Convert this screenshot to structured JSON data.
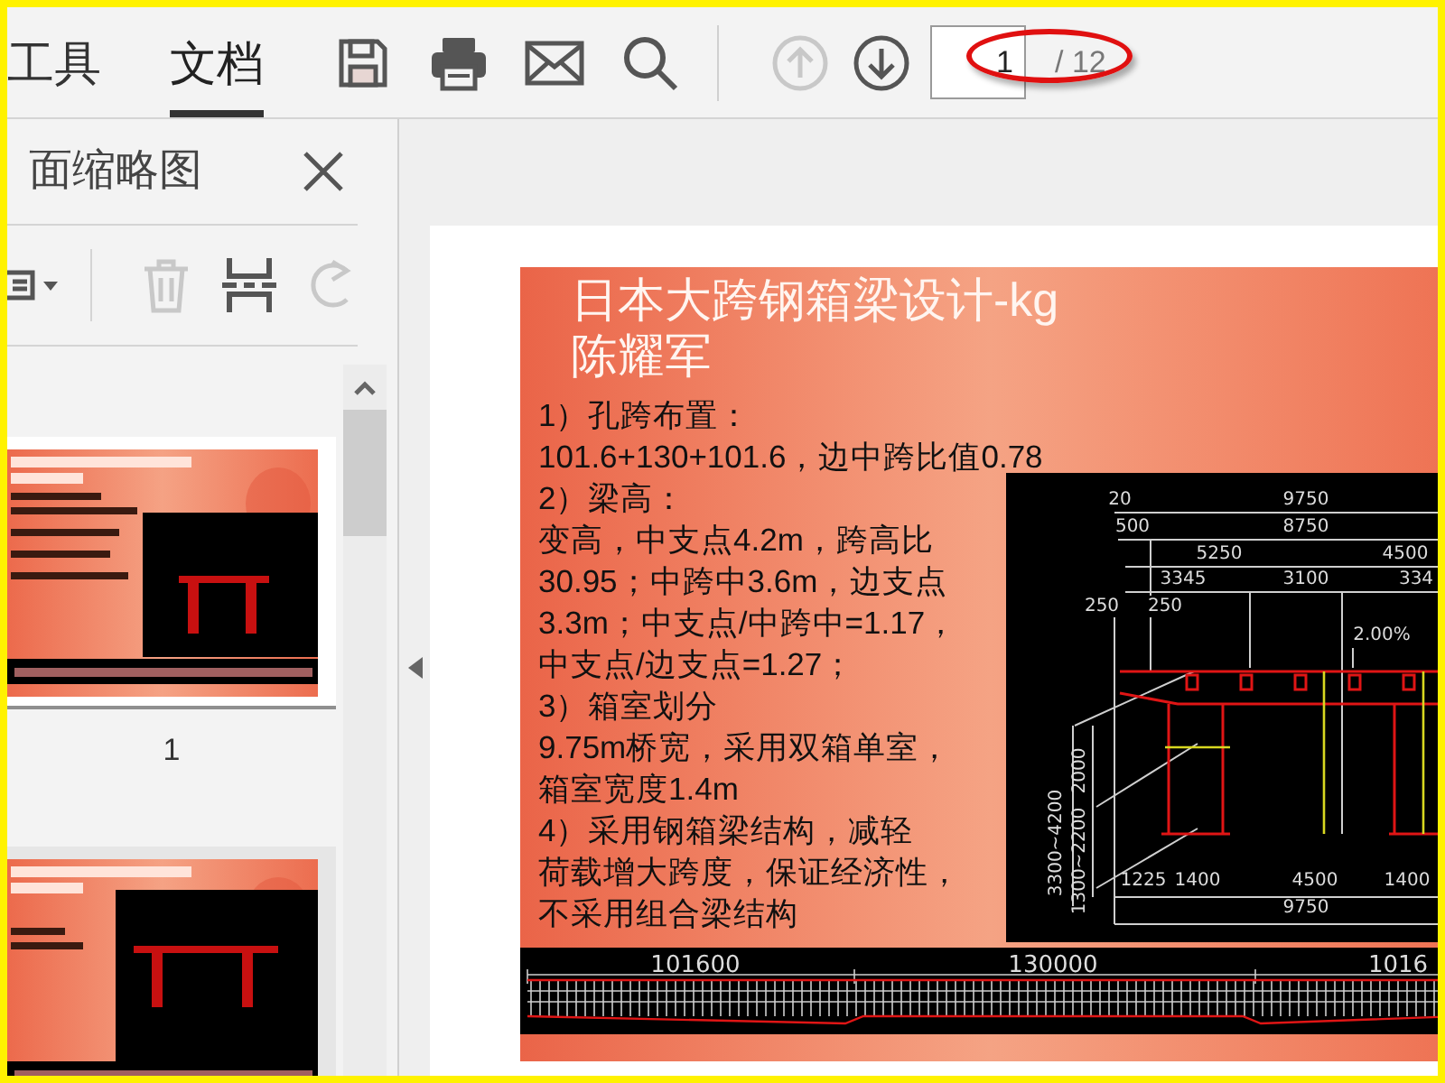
{
  "toolbar": {
    "tabs": [
      {
        "label": "工具",
        "selected": false
      },
      {
        "label": "文档",
        "selected": true
      }
    ],
    "actions": [
      {
        "kind": "save",
        "disabled": false
      },
      {
        "kind": "print",
        "disabled": false
      },
      {
        "kind": "mail",
        "disabled": false
      },
      {
        "kind": "search",
        "disabled": false
      }
    ],
    "navigation": [
      {
        "kind": "previous",
        "disabled": true
      },
      {
        "kind": "next",
        "disabled": false
      }
    ],
    "page_field": {
      "value": "1",
      "total": "/ 12"
    }
  },
  "thumbnail_panel": {
    "title": "面缩略图",
    "tools": [
      {
        "kind": "options",
        "disabled": false
      },
      {
        "kind": "delete",
        "disabled": true
      },
      {
        "kind": "extract",
        "disabled": false
      },
      {
        "kind": "rotate",
        "disabled": true
      }
    ],
    "thumbnails": [
      {
        "label": "1",
        "selected": true,
        "kind": "picture"
      },
      {
        "selected": false,
        "kind": "picture"
      }
    ]
  },
  "document": {
    "slide": {
      "title": "日本大跨钢箱梁设计-kg",
      "author": "陈耀军",
      "lines": [
        "1）孔跨布置：",
        "101.6+130+101.6，边中跨比值0.78",
        "2）梁高：",
        "变高，中支点4.2m，跨高比",
        "30.95；中跨中3.6m，边支点",
        "3.3m；中支点/中跨中=1.17，",
        "中支点/边支点=1.27；",
        "3）箱室划分",
        "9.75m桥宽，采用双箱单室，",
        "箱室宽度1.4m",
        "4）采用钢箱梁结构，减轻",
        "荷载增大跨度，保证经济性，",
        "不采用组合梁结构"
      ],
      "section_labels": [
        "20",
        "9750",
        "500",
        "8750",
        "5250",
        "4500",
        "3345",
        "3100",
        "334",
        "250",
        "250",
        "2.00%",
        "3300~4200",
        "1300~2200",
        "2000",
        "1225",
        "1400",
        "4500",
        "1400",
        "9750"
      ],
      "elevation_labels": [
        "101600",
        "130000",
        "1016"
      ]
    }
  }
}
